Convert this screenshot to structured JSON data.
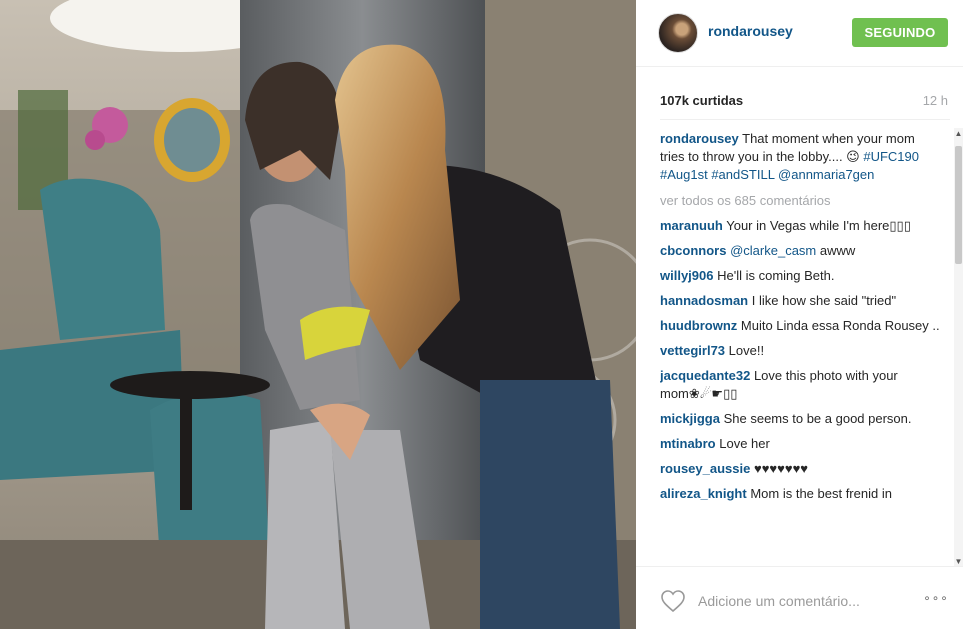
{
  "post": {
    "username": "rondarousey",
    "follow_label": "SEGUINDO",
    "likes": "107k curtidas",
    "time": "12 h"
  },
  "caption": {
    "user": "rondarousey",
    "text": "That moment when your mom tries to throw you in the lobby.... 😉 ",
    "tags": "#UFC190 #Aug1st #andSTILL @annmaria7gen"
  },
  "view_all": "ver todos os 685 comentários",
  "comments": [
    {
      "user": "maranuuh",
      "text": "Your in Vegas while I'm here▯▯▯"
    },
    {
      "user": "cbconnors",
      "mention": "@clarke_casm",
      "text": " awww"
    },
    {
      "user": "willyj906",
      "text": "He'll is coming Beth."
    },
    {
      "user": "hannadosman",
      "text": "I like how she said \"tried\""
    },
    {
      "user": "huudbrownz",
      "text": "Muito Linda essa Ronda Rousey .."
    },
    {
      "user": "vettegirl73",
      "text": "Love!!"
    },
    {
      "user": "jacquedante32",
      "text": "Love this photo with your mom❀☄☛▯▯"
    },
    {
      "user": "mickjigga",
      "text": "She seems to be a good person."
    },
    {
      "user": "mtinabro",
      "text": "Love her"
    },
    {
      "user": "rousey_aussie",
      "text": "♥♥♥♥♥♥♥"
    },
    {
      "user": "alireza_knight",
      "text": "Mom is the best frenid in"
    }
  ],
  "comment_input": {
    "placeholder": "Adicione um comentário..."
  },
  "more_label": "∘∘∘",
  "icons": {
    "heart": "heart-icon",
    "more": "more-options-icon"
  },
  "colors": {
    "username": "#125688",
    "follow": "#70c050"
  }
}
